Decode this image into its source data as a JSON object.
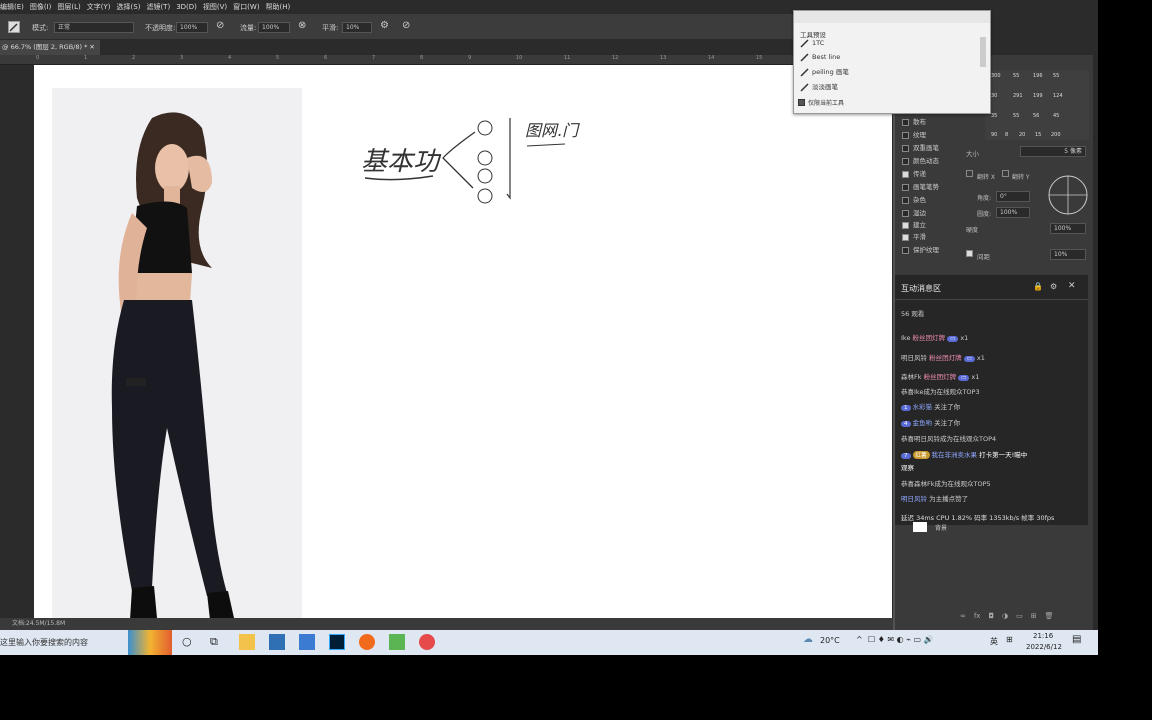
{
  "menubar": {
    "items": [
      "编辑(E)",
      "图像(I)",
      "图层(L)",
      "文字(Y)",
      "选择(S)",
      "滤镜(T)",
      "3D(D)",
      "视图(V)",
      "窗口(W)",
      "帮助(H)"
    ]
  },
  "options": {
    "mode_label": "模式:",
    "mode_value": "正常",
    "opacity_label": "不透明度:",
    "opacity_value": "100%",
    "flow_label": "流量:",
    "flow_value": "100%",
    "smooth_label": "平滑:",
    "smooth_value": "10%"
  },
  "document": {
    "tab_title": "@ 66.7% (图层 2, RGB/8) *",
    "ruler_ticks": [
      "0",
      "1",
      "2",
      "3",
      "4",
      "5",
      "6",
      "7",
      "8",
      "9",
      "10",
      "11",
      "12",
      "13",
      "14",
      "15"
    ],
    "status": "文档:24.5M/15.8M"
  },
  "handwriting": {
    "text1": "基本功",
    "text2": "图网.门"
  },
  "tool_presets": {
    "title": "工具预设",
    "items": [
      "1TC",
      "Best line",
      "peiling 画笔",
      "淡淡画笔"
    ],
    "current_only": "仅限当前工具"
  },
  "brush_numbers": [
    "300",
    "55",
    "196",
    "55",
    "30",
    "291",
    "199",
    "124",
    "35",
    "55",
    "56",
    "45",
    "90",
    "8",
    "20",
    "15",
    "200"
  ],
  "brush_settings": {
    "size_label": "大小",
    "size_value": "5 像素",
    "flip_x": "翻转 X",
    "flip_y": "翻转 Y",
    "angle_label": "角度:",
    "angle_value": "0°",
    "roundness_label": "圆度:",
    "roundness_value": "100%",
    "hardness_label": "硬度",
    "hardness_value": "100%",
    "spacing_label": "间距",
    "spacing_value": "10%"
  },
  "brush_options": [
    {
      "label": "散布",
      "on": false
    },
    {
      "label": "纹理",
      "on": false
    },
    {
      "label": "双重画笔",
      "on": false
    },
    {
      "label": "颜色动态",
      "on": false
    },
    {
      "label": "传递",
      "on": true
    },
    {
      "label": "画笔笔势",
      "on": false
    },
    {
      "label": "杂色",
      "on": false
    },
    {
      "label": "湿边",
      "on": false
    },
    {
      "label": "建立",
      "on": true
    },
    {
      "label": "平滑",
      "on": true
    },
    {
      "label": "保护纹理",
      "on": false
    }
  ],
  "chat": {
    "title": "互动消息区",
    "viewer_count": "56",
    "viewer_label": "观看",
    "gifts": [
      {
        "user": "Ike",
        "gift": "粉丝团灯牌",
        "count": "x1"
      },
      {
        "user": "明日风铃",
        "gift": "粉丝团灯牌",
        "count": "x1"
      },
      {
        "user": "森林Fk",
        "gift": "粉丝团灯牌",
        "count": "x1"
      }
    ],
    "messages": [
      {
        "text": "恭喜Ike成为在线观众TOP3"
      },
      {
        "level": "1",
        "user": "水彩猫",
        "text": "关注了你"
      },
      {
        "level": "4",
        "user": "金鱼哟",
        "text": "关注了你"
      },
      {
        "text": "恭喜明日风铃成为在线观众TOP4"
      },
      {
        "level": "7",
        "tag": "红薯",
        "user": "我在非洲卖水果",
        "text": "打卡第一天!瞄中"
      },
      {
        "text": "观察"
      },
      {
        "text": "恭喜森林Fk成为在线观众TOP5"
      },
      {
        "user": "明日风铃",
        "text": "为主播点赞了"
      }
    ],
    "stats": "延迟 34ms   CPU 1.82%   码率 1353kb/s   帧率 30fps"
  },
  "layers": {
    "bg": "背景"
  },
  "taskbar": {
    "search_placeholder": "这里输入你要搜索的内容",
    "weather": "20°C",
    "ime": "英",
    "time": "21:16",
    "date": "2022/6/12"
  }
}
